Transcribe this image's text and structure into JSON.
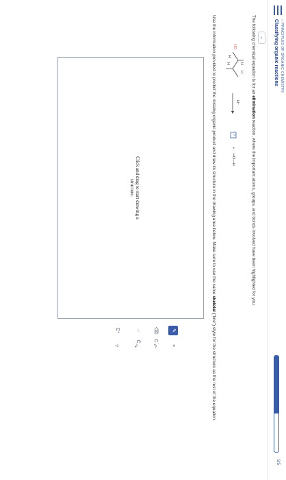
{
  "header": {
    "kicker": "○ PRINCIPLES OF ORGANIC CHEMISTRY",
    "title": "Classifying organic reactions",
    "progress_label": "3/5",
    "progress_fraction": 0.6
  },
  "question": {
    "intro_before": "The following chemical equation is for an ",
    "intro_bold": "elimination",
    "intro_after": " reaction, where the important atoms, groups, and bonds involved have been highlighted for you:",
    "instructions_before": "Use the information provided to predict the missing organic product and draw its structure in the drawing area below. Make sure to use the same ",
    "instructions_bold": "skeletal",
    "instructions_after": " (\"line\") style for the structure as the rest of the equation."
  },
  "equation": {
    "reactant_label": "HO",
    "h_labels": [
      "H",
      "H",
      "H",
      "H"
    ],
    "condition": "H⁺",
    "product_box": "?",
    "plus": "+",
    "byproduct": "HO—H"
  },
  "drawing": {
    "prompt_line1": "Click and drag to start drawing a",
    "prompt_line2": "structure."
  },
  "toolbar": {
    "x_label": "×",
    "carbocation": "C⁺",
    "radical": "C˙",
    "lone_pair": "C̈",
    "help": "?"
  }
}
